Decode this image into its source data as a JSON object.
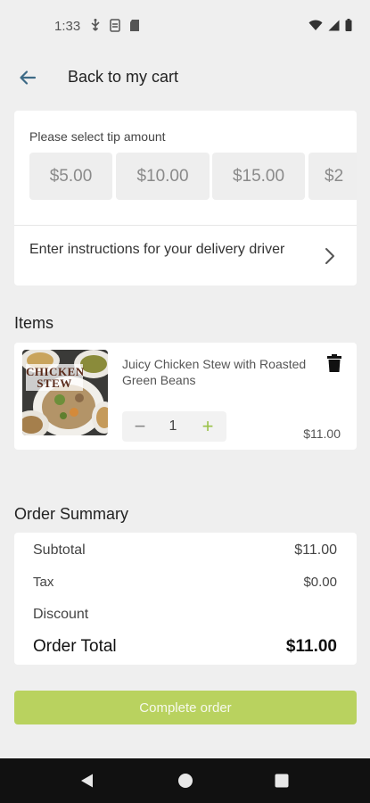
{
  "status_bar": {
    "time": "1:33",
    "left_icons": [
      "usb-icon",
      "sim-icon",
      "sd-card-icon"
    ],
    "right_icons": [
      "wifi-icon",
      "signal-icon",
      "battery-icon"
    ]
  },
  "header": {
    "back_icon": "arrow-left-icon",
    "title": "Back to my cart"
  },
  "tip": {
    "prompt": "Please select tip amount",
    "options": [
      "$5.00",
      "$10.00",
      "$15.00",
      "$2"
    ]
  },
  "instructions": {
    "label": "Enter instructions for your delivery driver"
  },
  "items": {
    "heading": "Items",
    "list": [
      {
        "image_label": "CHICKEN STEW",
        "name": "Juicy Chicken Stew with Roasted Green Beans",
        "quantity": "1",
        "minus": "−",
        "plus": "+",
        "price": "$11.00"
      }
    ]
  },
  "summary": {
    "heading": "Order Summary",
    "subtotal_label": "Subtotal",
    "subtotal_value": "$11.00",
    "tax_label": "Tax",
    "tax_value": "$0.00",
    "discount_label": "Discount",
    "discount_value": "",
    "total_label": "Order Total",
    "total_value": "$11.00"
  },
  "complete_button": "Complete order",
  "colors": {
    "accent_green": "#b9d25f",
    "plus_green": "#9bc24a",
    "background": "#efefef",
    "back_arrow": "#3d6a86"
  }
}
